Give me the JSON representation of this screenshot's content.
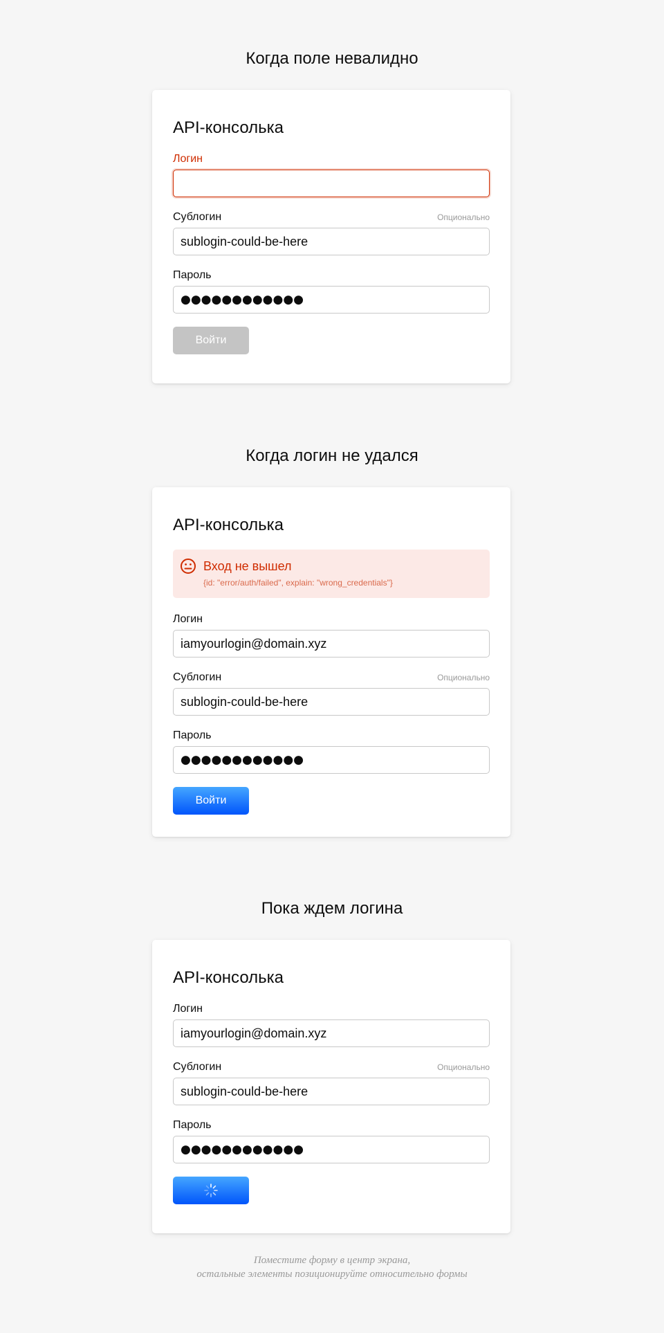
{
  "sections": [
    {
      "heading": "Когда поле невалидно",
      "card": {
        "title": "API-консолька",
        "login": {
          "label": "Логин",
          "value": ""
        },
        "sublogin": {
          "label": "Сублогин",
          "hint": "Опционально",
          "value": "sublogin-could-be-here"
        },
        "password": {
          "label": "Пароль",
          "value": "●●●●●●●●●●●●"
        },
        "submit": {
          "label": "Войти",
          "state": "disabled"
        }
      }
    },
    {
      "heading": "Когда логин не удался",
      "card": {
        "title": "API-консолька",
        "error": {
          "icon": "neutral-face-icon",
          "title": "Вход не вышел",
          "detail": "{id: \"error/auth/failed\", explain: \"wrong_credentials\"}"
        },
        "login": {
          "label": "Логин",
          "value": "iamyourlogin@domain.xyz"
        },
        "sublogin": {
          "label": "Сублогин",
          "hint": "Опционально",
          "value": "sublogin-could-be-here"
        },
        "password": {
          "label": "Пароль",
          "value": "●●●●●●●●●●●●"
        },
        "submit": {
          "label": "Войти",
          "state": "enabled"
        }
      }
    },
    {
      "heading": "Пока ждем логина",
      "card": {
        "title": "API-консолька",
        "login": {
          "label": "Логин",
          "value": "iamyourlogin@domain.xyz"
        },
        "sublogin": {
          "label": "Сублогин",
          "hint": "Опционально",
          "value": "sublogin-could-be-here"
        },
        "password": {
          "label": "Пароль",
          "value": "●●●●●●●●●●●●"
        },
        "submit": {
          "icon": "spinner-icon",
          "state": "loading"
        }
      }
    }
  ],
  "footer": {
    "line1": "Поместите форму в центр экрана,",
    "line2": "остальные элементы позиционируйте относительно формы"
  },
  "colors": {
    "page_background": "#f6f6f6",
    "error": "#cf2c00",
    "error_background": "#fce9e6",
    "primary_top": "#45a6ff",
    "primary_bottom": "#0055fb",
    "disabled_button": "#c4c4c4"
  }
}
